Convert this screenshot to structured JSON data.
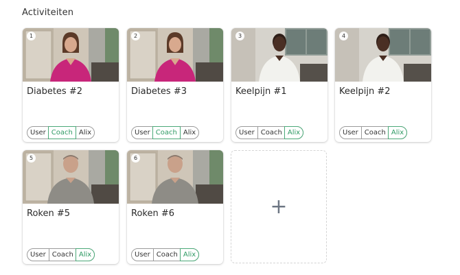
{
  "section": {
    "title": "Activiteiten"
  },
  "colors": {
    "active": "#2e9a63",
    "plus": "#6d7683"
  },
  "cards": [
    {
      "num": "1",
      "title": "Diabetes #2",
      "avatar": "woman-pink",
      "modes": [
        "User",
        "Coach",
        "Alix"
      ],
      "active": "Coach"
    },
    {
      "num": "2",
      "title": "Diabetes #3",
      "avatar": "woman-pink",
      "modes": [
        "User",
        "Coach",
        "Alix"
      ],
      "active": "Coach"
    },
    {
      "num": "3",
      "title": "Keelpijn #1",
      "avatar": "man-white-shirt",
      "modes": [
        "User",
        "Coach",
        "Alix"
      ],
      "active": "Alix"
    },
    {
      "num": "4",
      "title": "Keelpijn #2",
      "avatar": "man-white-shirt",
      "modes": [
        "User",
        "Coach",
        "Alix"
      ],
      "active": "Alix"
    },
    {
      "num": "5",
      "title": "Roken #5",
      "avatar": "man-grey-polo",
      "modes": [
        "User",
        "Coach",
        "Alix"
      ],
      "active": "Alix"
    },
    {
      "num": "6",
      "title": "Roken #6",
      "avatar": "man-grey-polo",
      "modes": [
        "User",
        "Coach",
        "Alix"
      ],
      "active": "Alix"
    }
  ],
  "add": {
    "icon": "plus-icon",
    "label": "+"
  }
}
